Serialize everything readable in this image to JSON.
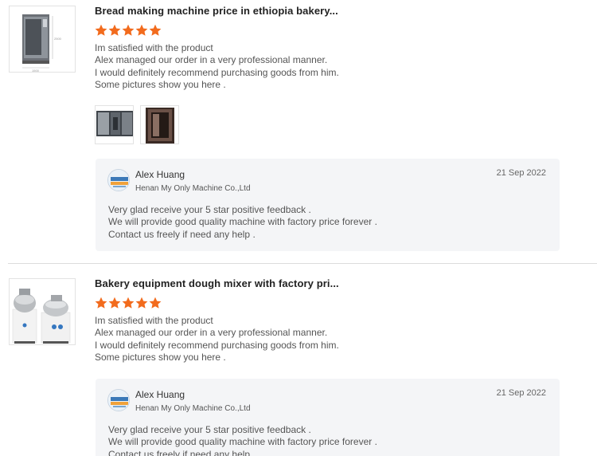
{
  "reviews": [
    {
      "title": "Bread making machine price in ethiopia bakery...",
      "rating": 5,
      "lines": [
        "Im satisfied with the product",
        "Alex managed our order in a very professional manner.",
        "I would definitely recommend purchasing goods from him.",
        "Some pictures show you here ."
      ],
      "reply": {
        "name": "Alex Huang",
        "company": "Henan My Only Machine Co.,Ltd",
        "date": "21 Sep 2022",
        "lines": [
          "Very glad receive your 5 star positive feedback .",
          "We will provide good quality machine with factory price forever .",
          "Contact us freely if need any help ."
        ]
      }
    },
    {
      "title": "Bakery equipment dough mixer with factory pri...",
      "rating": 5,
      "lines": [
        "Im satisfied with the product",
        "Alex managed our order in a very professional manner.",
        "I would definitely recommend purchasing goods from him.",
        "Some pictures show you here ."
      ],
      "reply": {
        "name": "Alex Huang",
        "company": "Henan My Only Machine Co.,Ltd",
        "date": "21 Sep 2022",
        "lines": [
          "Very glad receive your 5 star positive feedback .",
          "We will provide good quality machine with factory price forever .",
          "Contact us freely if need any help ."
        ]
      }
    }
  ],
  "colors": {
    "star": "#f26b1d",
    "reply_bg": "#f4f5f7"
  }
}
